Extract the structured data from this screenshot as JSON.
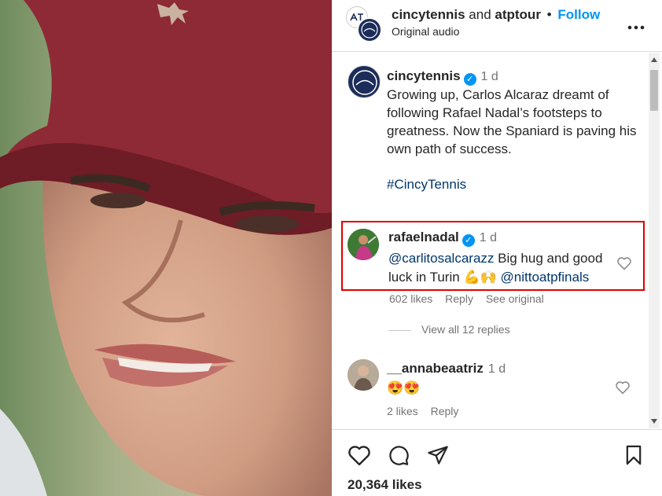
{
  "header": {
    "user1": "cincytennis",
    "joiner": "and",
    "user2": "atptour",
    "separator": "•",
    "follow_label": "Follow",
    "audio_label": "Original audio",
    "more_icon": "more-horizontal-icon"
  },
  "caption": {
    "username": "cincytennis",
    "verified": "✓",
    "time": "1 d",
    "text": "Growing up, Carlos Alcaraz dreamt of following Rafael Nadal’s footsteps to greatness. Now the Spaniard is paving his own path of success.",
    "hashtag": "#CincyTennis"
  },
  "comment1": {
    "username": "rafaelnadal",
    "verified": "✓",
    "time": "1 d",
    "mention1": "@carlitosalcarazz",
    "text_part1": " Big hug and good luck in Turin ",
    "emojis": "💪🙌",
    "mention2": "@nittoatpfinals",
    "likes": "602 likes",
    "reply_label": "Reply",
    "see_original": "See original",
    "view_replies": "View all 12 replies"
  },
  "comment2": {
    "username": "__annabeaatriz",
    "time": "1 d",
    "text": "😍😍",
    "likes": "2 likes",
    "reply_label": "Reply"
  },
  "footer": {
    "likes": "20,364 likes"
  },
  "colors": {
    "accent": "#0095f6",
    "highlight_border": "#e00000",
    "link": "#00376b",
    "muted": "#737373"
  }
}
